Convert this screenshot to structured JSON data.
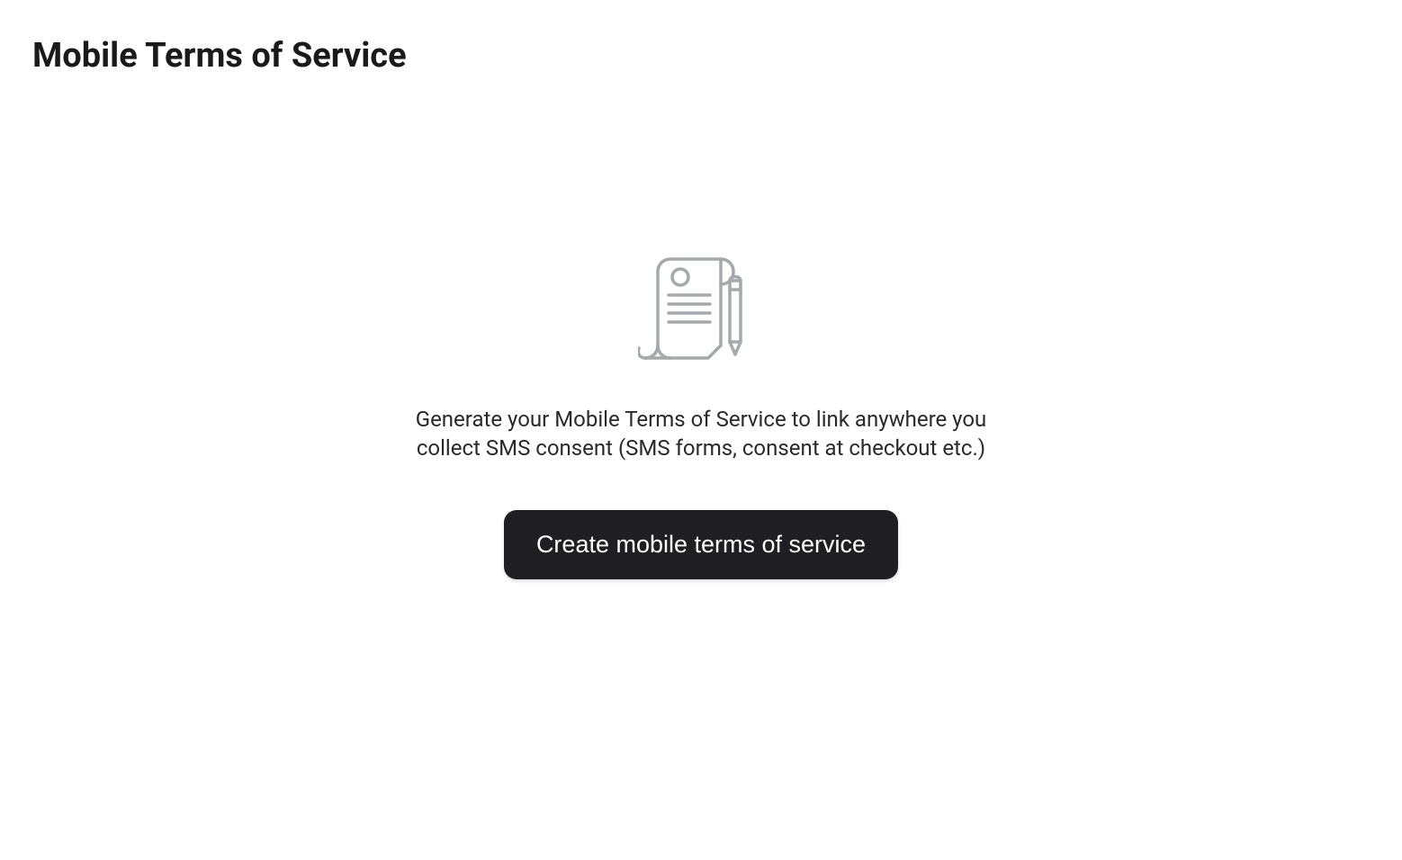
{
  "header": {
    "title": "Mobile Terms of Service"
  },
  "emptyState": {
    "description": "Generate your Mobile Terms of Service to link anywhere you collect SMS consent (SMS forms, consent at checkout etc.)",
    "buttonLabel": "Create mobile terms of service"
  }
}
